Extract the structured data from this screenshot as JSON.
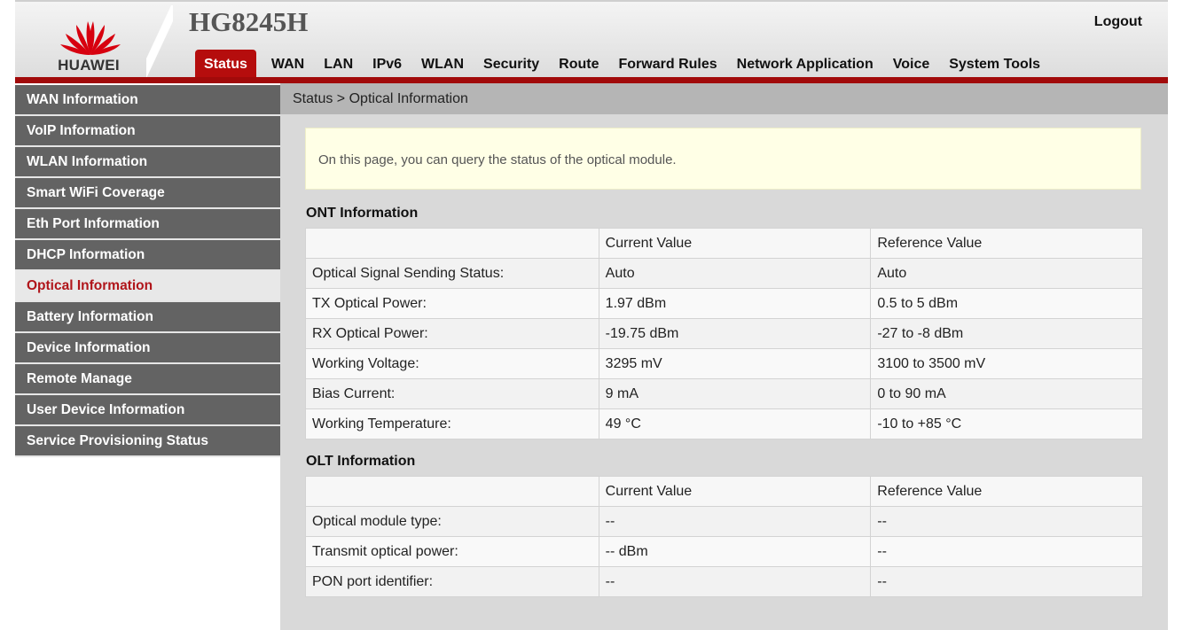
{
  "header": {
    "brand": "HUAWEI",
    "model": "HG8245H",
    "logout_label": "Logout",
    "brand_color": "#b50d0d"
  },
  "nav": {
    "items": [
      "Status",
      "WAN",
      "LAN",
      "IPv6",
      "WLAN",
      "Security",
      "Route",
      "Forward Rules",
      "Network Application",
      "Voice",
      "System Tools"
    ],
    "active": "Status"
  },
  "sidebar": {
    "items": [
      "WAN Information",
      "VoIP Information",
      "WLAN Information",
      "Smart WiFi Coverage",
      "Eth Port Information",
      "DHCP Information",
      "Optical Information",
      "Battery Information",
      "Device Information",
      "Remote Manage",
      "User Device Information",
      "Service Provisioning Status"
    ],
    "active": "Optical Information"
  },
  "main": {
    "breadcrumb": "Status > Optical Information",
    "notice": "On this page, you can query the status of the optical module.",
    "ont": {
      "title": "ONT Information",
      "headers": [
        "",
        "Current Value",
        "Reference Value"
      ],
      "rows": [
        [
          "Optical Signal Sending Status:",
          "Auto",
          "Auto"
        ],
        [
          "TX Optical Power:",
          "1.97 dBm",
          "0.5 to 5 dBm"
        ],
        [
          "RX Optical Power:",
          "-19.75 dBm",
          "-27 to -8 dBm"
        ],
        [
          "Working Voltage:",
          "3295 mV",
          "3100 to 3500 mV"
        ],
        [
          "Bias Current:",
          "9 mA",
          "0 to 90 mA"
        ],
        [
          "Working Temperature:",
          "49 °C",
          "-10 to +85 °C"
        ]
      ]
    },
    "olt": {
      "title": "OLT Information",
      "headers": [
        "",
        "Current Value",
        "Reference Value"
      ],
      "rows": [
        [
          "Optical module type:",
          "--",
          "--"
        ],
        [
          "Transmit optical power:",
          "-- dBm",
          "--"
        ],
        [
          "PON port identifier:",
          "--",
          "--"
        ]
      ]
    }
  }
}
